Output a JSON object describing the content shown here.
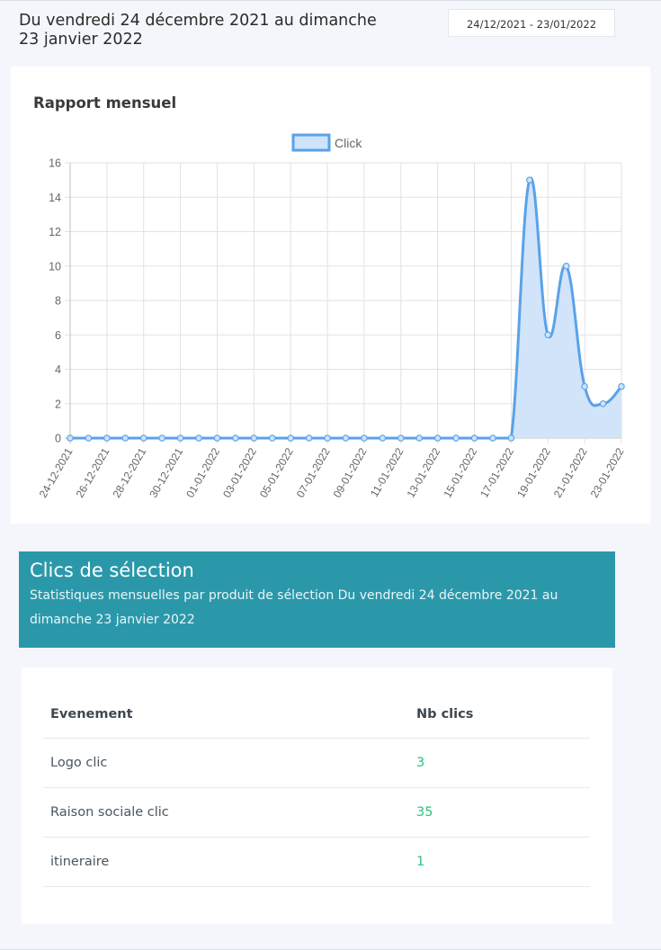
{
  "header": {
    "title": "Du vendredi 24 décembre 2021 au dimanche 23 janvier 2022",
    "date_range": "24/12/2021 - 23/01/2022"
  },
  "report": {
    "title": "Rapport mensuel"
  },
  "chart_data": {
    "type": "area",
    "legend": "Click",
    "legend_position": "top-center",
    "grid": true,
    "ylim": [
      0,
      16
    ],
    "yticks": [
      0,
      2,
      4,
      6,
      8,
      10,
      12,
      14,
      16
    ],
    "x": [
      "24-12-2021",
      "25-12-2021",
      "26-12-2021",
      "27-12-2021",
      "28-12-2021",
      "29-12-2021",
      "30-12-2021",
      "31-12-2021",
      "01-01-2022",
      "02-01-2022",
      "03-01-2022",
      "04-01-2022",
      "05-01-2022",
      "06-01-2022",
      "07-01-2022",
      "08-01-2022",
      "09-01-2022",
      "10-01-2022",
      "11-01-2022",
      "12-01-2022",
      "13-01-2022",
      "14-01-2022",
      "15-01-2022",
      "16-01-2022",
      "17-01-2022",
      "18-01-2022",
      "19-01-2022",
      "20-01-2022",
      "21-01-2022",
      "22-01-2022",
      "23-01-2022"
    ],
    "xtick_labels": [
      "24-12-2021",
      "26-12-2021",
      "28-12-2021",
      "30-12-2021",
      "01-01-2022",
      "03-01-2022",
      "05-01-2022",
      "07-01-2022",
      "09-01-2022",
      "11-01-2022",
      "13-01-2022",
      "15-01-2022",
      "17-01-2022",
      "19-01-2022",
      "21-01-2022",
      "23-01-2022"
    ],
    "series": [
      {
        "name": "Click",
        "values": [
          0,
          0,
          0,
          0,
          0,
          0,
          0,
          0,
          0,
          0,
          0,
          0,
          0,
          0,
          0,
          0,
          0,
          0,
          0,
          0,
          0,
          0,
          0,
          0,
          0,
          15,
          6,
          10,
          3,
          2,
          3
        ]
      }
    ],
    "colors": {
      "line": "#5aa2e8",
      "fill": "#cfe3fa"
    }
  },
  "selection": {
    "title": "Clics de sélection",
    "subtitle": "Statistiques mensuelles par produit de sélection Du vendredi 24 décembre 2021 au dimanche 23 janvier 2022"
  },
  "table": {
    "headers": {
      "event": "Evenement",
      "clicks": "Nb clics"
    },
    "rows": [
      {
        "event": "Logo clic",
        "clicks": "3"
      },
      {
        "event": "Raison sociale clic",
        "clicks": "35"
      },
      {
        "event": "itineraire",
        "clicks": "1"
      }
    ]
  },
  "colors": {
    "banner": "#2b98aa",
    "click_value": "#2ec37a",
    "background": "#f4f6fb"
  }
}
